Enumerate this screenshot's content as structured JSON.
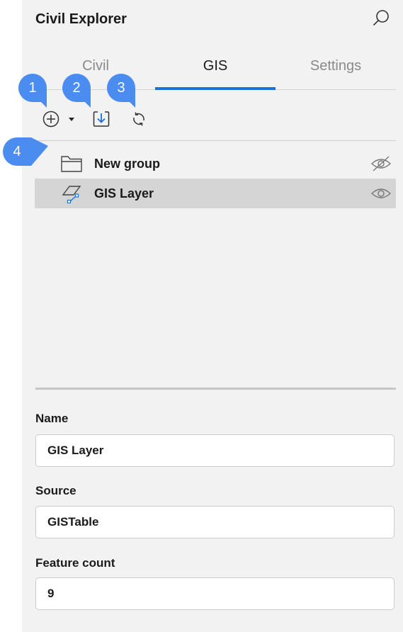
{
  "header": {
    "title": "Civil Explorer",
    "search_icon": "search-icon"
  },
  "tabs": [
    {
      "label": "Civil",
      "active": false
    },
    {
      "label": "GIS",
      "active": true
    },
    {
      "label": "Settings",
      "active": false
    }
  ],
  "toolbar": {
    "add_icon": "add-circle-icon",
    "dropdown_icon": "caret-down-icon",
    "import_icon": "import-icon",
    "refresh_icon": "refresh-icon"
  },
  "callouts": [
    "1",
    "2",
    "3",
    "4"
  ],
  "tree": [
    {
      "label": "New group",
      "icon": "folder-icon",
      "visibility": "hidden",
      "selected": false
    },
    {
      "label": "GIS Layer",
      "icon": "gis-layer-icon",
      "visibility": "visible",
      "selected": true
    }
  ],
  "properties": {
    "name_label": "Name",
    "name_value": "GIS Layer",
    "source_label": "Source",
    "source_value": "GISTable",
    "count_label": "Feature count",
    "count_value": "9"
  },
  "colors": {
    "accent": "#1e6fd9",
    "callout": "#4a8cf0",
    "panel_bg": "#f2f2f2",
    "selected_row": "#d5d5d5"
  }
}
